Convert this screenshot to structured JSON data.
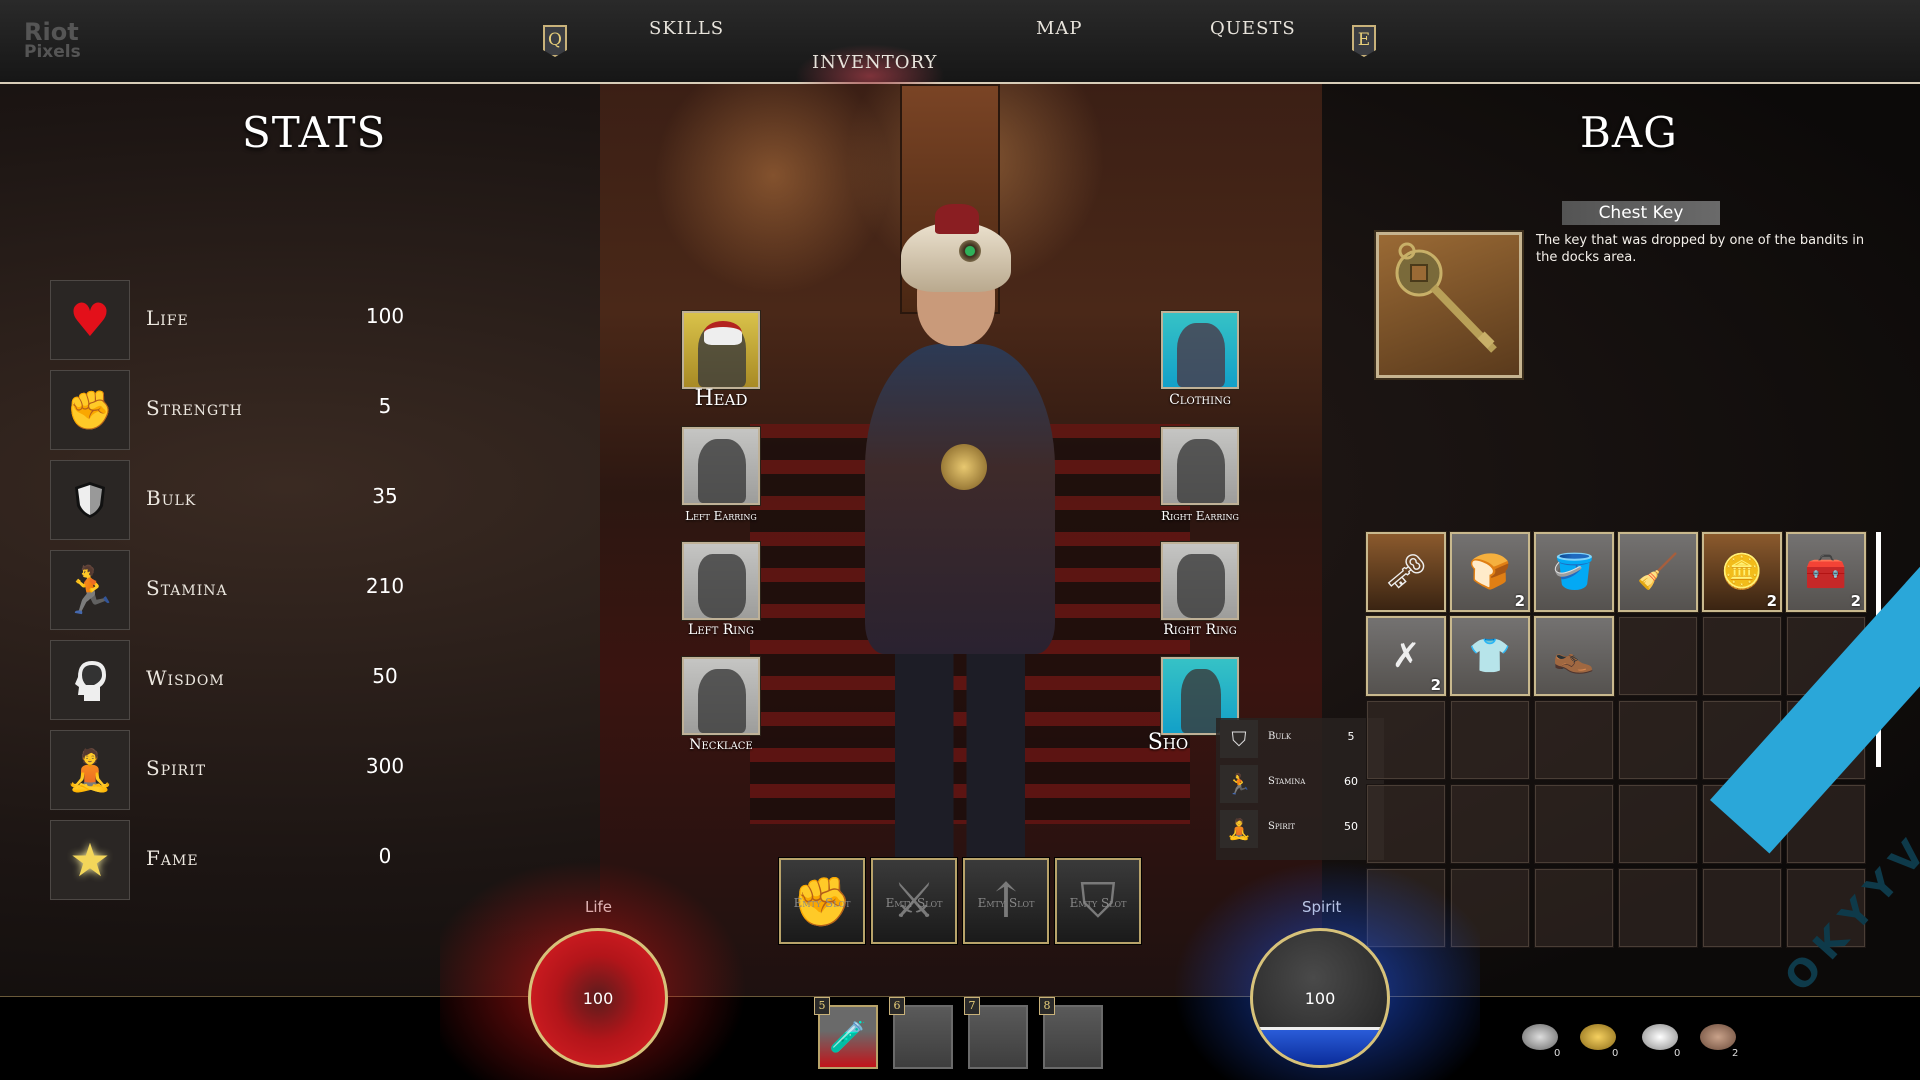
{
  "watermark_logo": {
    "line1": "Riot",
    "line2": "Pixels"
  },
  "nav": {
    "left_key": "Q",
    "right_key": "E",
    "tabs": [
      {
        "label": "SKILLS",
        "active": false
      },
      {
        "label": "INVENTORY",
        "active": true
      },
      {
        "label": "MAP",
        "active": false
      },
      {
        "label": "QUESTS",
        "active": false
      }
    ]
  },
  "stats": {
    "title": "STATS",
    "rows": [
      {
        "icon": "heart-icon",
        "label": "Life",
        "value": "100"
      },
      {
        "icon": "fist-icon",
        "label": "Strength",
        "value": "5"
      },
      {
        "icon": "shield-icon",
        "label": "Bulk",
        "value": "35"
      },
      {
        "icon": "running-man-icon",
        "label": "Stamina",
        "value": "210"
      },
      {
        "icon": "brain-head-icon",
        "label": "Wisdom",
        "value": "50"
      },
      {
        "icon": "meditation-icon",
        "label": "Spirit",
        "value": "300"
      },
      {
        "icon": "star-icon",
        "label": "Fame",
        "value": "0"
      }
    ]
  },
  "equipment": {
    "left": [
      {
        "slot": "Head",
        "state": "equipped"
      },
      {
        "slot": "Left Earring",
        "state": "empty"
      },
      {
        "slot": "Left Ring",
        "state": "empty"
      },
      {
        "slot": "Necklace",
        "state": "empty"
      }
    ],
    "right": [
      {
        "slot": "Clothing",
        "state": "equipped"
      },
      {
        "slot": "Right Earring",
        "state": "empty"
      },
      {
        "slot": "Right Ring",
        "state": "empty"
      },
      {
        "slot": "Sho",
        "state": "equipped"
      }
    ],
    "weapon_slots": [
      {
        "icon": "fist-icon",
        "label": "Emty Slot"
      },
      {
        "icon": "scimitar-icon",
        "label": "Emty Slot"
      },
      {
        "icon": "arrow-icon",
        "label": "Emty Slot"
      },
      {
        "icon": "shield-icon",
        "label": "Emty Slot"
      }
    ]
  },
  "compare_tooltip": {
    "rows": [
      {
        "icon": "shield-icon",
        "label": "Bulk",
        "value": "5"
      },
      {
        "icon": "running-man-icon",
        "label": "Stamina",
        "value": "60"
      },
      {
        "icon": "meditation-icon",
        "label": "Spirit",
        "value": "50"
      }
    ]
  },
  "bag": {
    "title": "BAG",
    "selected_item": {
      "name": "Chest Key",
      "description": "The key that was dropped by one of the bandits in the docks area."
    },
    "items": [
      {
        "name": "chest-key",
        "qty": ""
      },
      {
        "name": "bread",
        "qty": "2"
      },
      {
        "name": "wooden-bucket",
        "qty": ""
      },
      {
        "name": "broom",
        "qty": ""
      },
      {
        "name": "coins",
        "qty": "2"
      },
      {
        "name": "toolbox",
        "qty": "2"
      },
      {
        "name": "lockpicks",
        "qty": "2"
      },
      {
        "name": "blue-shirt",
        "qty": ""
      },
      {
        "name": "red-shoes",
        "qty": ""
      }
    ],
    "total_slots": 30
  },
  "hud": {
    "life": {
      "label": "Life",
      "value": "100",
      "fill_fraction": 1.0
    },
    "spirit": {
      "label": "Spirit",
      "value": "100",
      "fill_fraction": 0.28
    },
    "quick_slots": [
      {
        "key": "5",
        "item": "health-potion"
      },
      {
        "key": "6",
        "item": ""
      },
      {
        "key": "7",
        "item": ""
      },
      {
        "key": "8",
        "item": ""
      }
    ],
    "currencies": [
      {
        "name": "diamond-coins",
        "count": "0"
      },
      {
        "name": "gold-coins",
        "count": "0"
      },
      {
        "name": "silver-coins",
        "count": "0"
      },
      {
        "name": "copper-coins",
        "count": "2"
      }
    ]
  },
  "watermark_corner": "OKYYV"
}
